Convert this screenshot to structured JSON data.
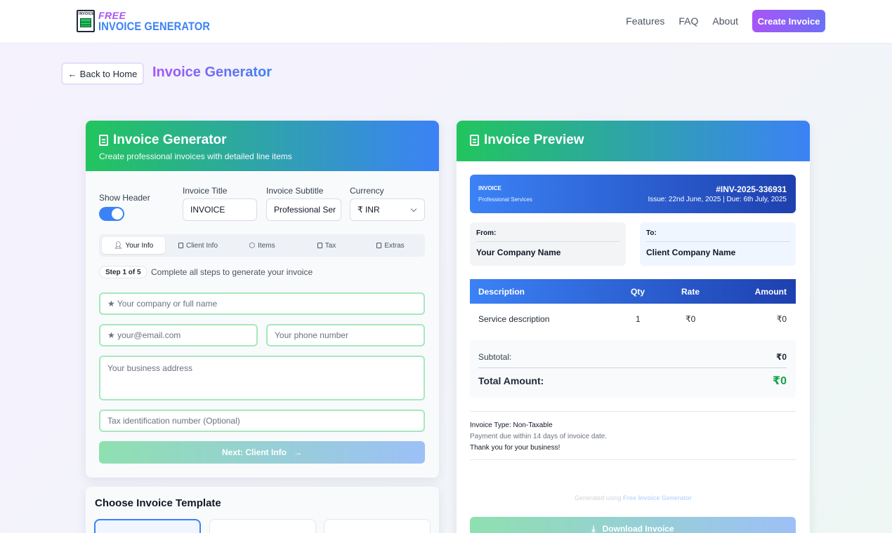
{
  "nav": {
    "logo_top": "FREE",
    "logo_name": "INVOICE GENERATOR",
    "logo_mark_text": "INVOICE",
    "links": [
      "Features",
      "FAQ",
      "About"
    ],
    "cta": "Create Invoice"
  },
  "page": {
    "back_label": "Back to Home",
    "title": "Invoice Generator"
  },
  "form": {
    "title": "Invoice Generator",
    "subtitle": "Create professional invoices with detailed line items",
    "show_header_label": "Show Header",
    "show_header": true,
    "invoice_title_label": "Invoice Title",
    "invoice_title_value": "INVOICE",
    "invoice_subtitle_label": "Invoice Subtitle",
    "invoice_subtitle_value": "Professional Ser",
    "currency_label": "Currency",
    "currency_value": "₹ INR",
    "tabs": [
      "Your Info",
      "Client Info",
      "Items",
      "Tax",
      "Extras"
    ],
    "active_tab": "Your Info",
    "step_badge": "Step 1 of 5",
    "step_text": "Complete all steps to generate your invoice",
    "fields": {
      "name_placeholder": "★ Your company or full name",
      "email_placeholder": "★ your@email.com",
      "phone_placeholder": "Your phone number",
      "address_placeholder": "Your business address",
      "tax_placeholder": "Tax identification number (Optional)"
    },
    "next_label": "Next: Client Info"
  },
  "templates": {
    "title": "Choose Invoice Template"
  },
  "preview": {
    "title": "Invoice Preview",
    "band_title": "INVOICE",
    "band_subtitle": "Professional Services",
    "invoice_number": "#INV-2025-336931",
    "dates": "Issue: 22nd June, 2025 | Due: 6th July, 2025",
    "from_label": "From:",
    "from_name": "Your Company Name",
    "to_label": "To:",
    "to_name": "Client Company Name",
    "columns": [
      "Description",
      "Qty",
      "Rate",
      "Amount"
    ],
    "rows": [
      {
        "description": "Service description",
        "qty": "1",
        "rate": "₹0",
        "amount": "₹0"
      }
    ],
    "subtotal_label": "Subtotal:",
    "subtotal_value": "₹0",
    "total_label": "Total Amount:",
    "total_value": "₹0",
    "invoice_type": "Invoice Type: Non-Taxable",
    "payment_terms": "Payment due within 14 days of invoice date.",
    "thanks": "Thank you for your business!",
    "generated_prefix": "Generated using",
    "generated_link": "Free Invoice Generator",
    "download_label": "Download Invoice"
  },
  "colors": {
    "green": "#22c55e",
    "blue": "#3b82f6",
    "purple": "#a855f7",
    "total_green": "#16a34a"
  }
}
